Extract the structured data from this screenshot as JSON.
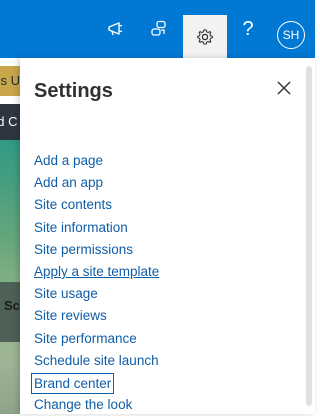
{
  "suitebar": {
    "icons": [
      "megaphone-icon",
      "feedback-icon",
      "gear-icon",
      "help-icon"
    ],
    "help_label": "?",
    "avatar_initials": "SH",
    "accent": "#0078d4"
  },
  "background": {
    "yellow_text": "cs U",
    "dark_text": "ed C",
    "bold_text": "Sc"
  },
  "panel": {
    "title": "Settings",
    "links": [
      "Add a page",
      "Add an app",
      "Site contents",
      "Site information",
      "Site permissions",
      "Apply a site template",
      "Site usage",
      "Site reviews",
      "Site performance",
      "Schedule site launch",
      "Brand center",
      "Change the look"
    ],
    "link_color": "#0f5ea8"
  }
}
